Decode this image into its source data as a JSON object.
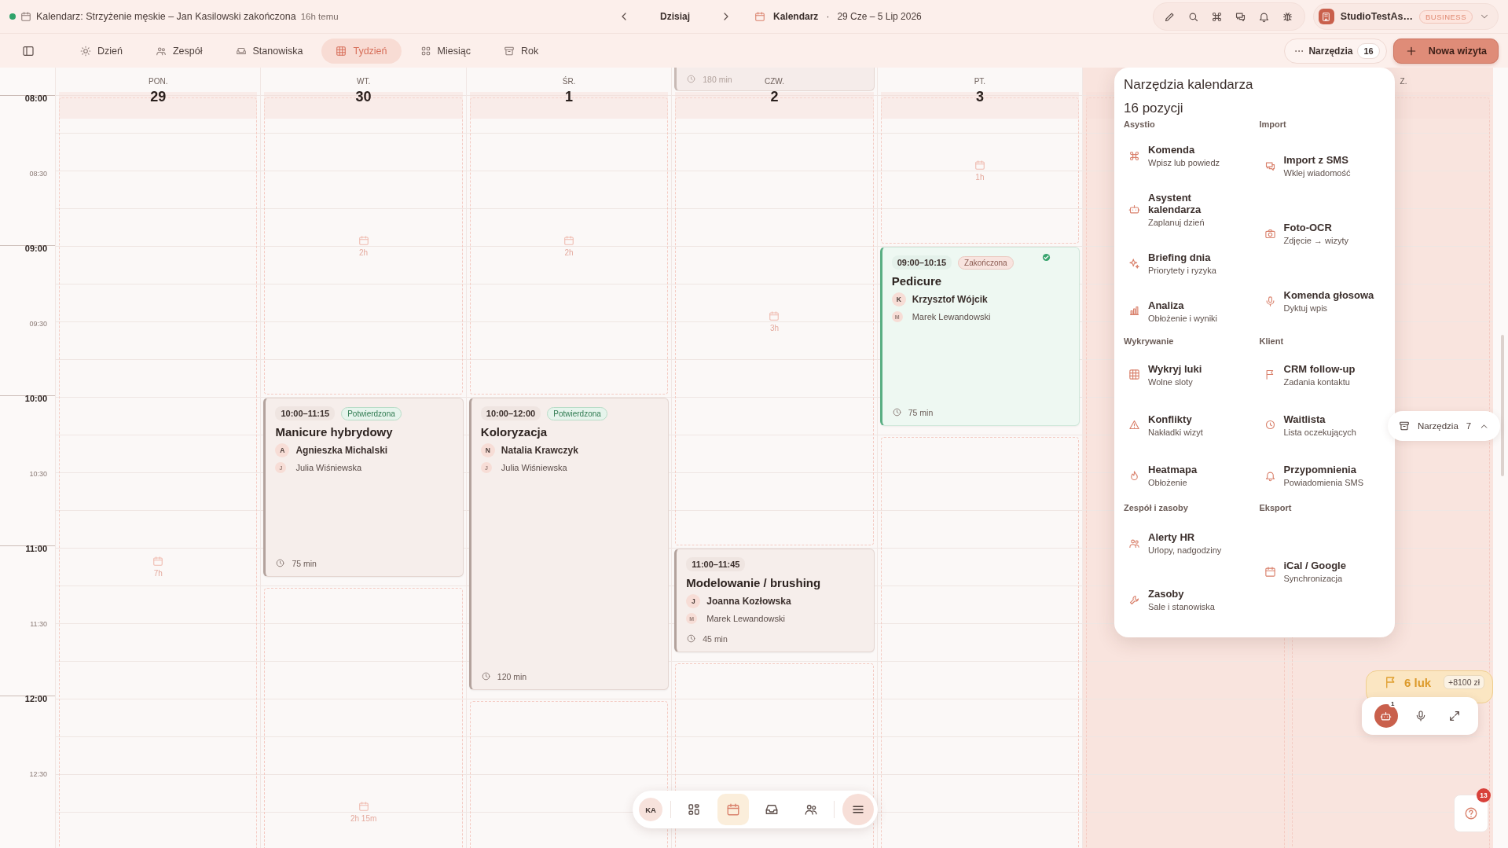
{
  "top_bar": {
    "status_title": "Kalendarz: Strzyżenie męskie – Jan Kasilowski zakończona",
    "status_time": "16h temu",
    "today": "Dzisiaj",
    "view_label": "Kalendarz",
    "separator": "·",
    "range": "29 Cze – 5 Lip 2026"
  },
  "account": {
    "name": "StudioTestAs…",
    "plan": "BUSINESS"
  },
  "toolbar": {
    "tabs": [
      {
        "label": "Dzień",
        "selected": false
      },
      {
        "label": "Zespół",
        "selected": false
      },
      {
        "label": "Stanowiska",
        "selected": false
      },
      {
        "label": "Tydzień",
        "selected": true
      },
      {
        "label": "Miesiąc",
        "selected": false
      },
      {
        "label": "Rok",
        "selected": false
      }
    ],
    "tools_button": {
      "dots": "···",
      "label": "Narzędzia",
      "count": "16"
    },
    "new_button": "Nowa wizyta"
  },
  "times": [
    {
      "label": "08:00",
      "major": true
    },
    {
      "label": "08:30",
      "major": false
    },
    {
      "label": "09:00",
      "major": true
    },
    {
      "label": "09:30",
      "major": false
    },
    {
      "label": "10:00",
      "major": true
    },
    {
      "label": "10:30",
      "major": false
    },
    {
      "label": "11:00",
      "major": true
    },
    {
      "label": "11:30",
      "major": false
    },
    {
      "label": "12:00",
      "major": true
    },
    {
      "label": "12:30",
      "major": false
    }
  ],
  "days": [
    {
      "label": "PON.",
      "number": "29",
      "weekend": false,
      "slots": [
        {
          "kind": "free",
          "label": "7h"
        }
      ]
    },
    {
      "label": "WT.",
      "number": "30",
      "weekend": false,
      "slots": [
        {
          "kind": "free",
          "label": "2h"
        },
        {
          "kind": "event",
          "time": "10:00–11:15",
          "status": "Potwierdzona",
          "completed": false,
          "title": "Manicure hybrydowy",
          "client": {
            "initial": "A",
            "name": "Agnieszka Michalski"
          },
          "staff": {
            "initial": "J",
            "name": "Julia Wiśniewska"
          },
          "duration": "75 min"
        },
        {
          "kind": "free",
          "label": "2h 15m"
        }
      ]
    },
    {
      "label": "ŚR.",
      "number": "1",
      "weekend": false,
      "slots": [
        {
          "kind": "free",
          "label": "2h"
        },
        {
          "kind": "event",
          "time": "10:00–12:00",
          "status": "Potwierdzona",
          "completed": false,
          "title": "Koloryzacja",
          "client": {
            "initial": "N",
            "name": "Natalia Krawczyk"
          },
          "staff": {
            "initial": "J",
            "name": "Julia Wiśniewska"
          },
          "duration": "120 min"
        },
        {
          "kind": "free"
        }
      ]
    },
    {
      "label": "CZW.",
      "number": "2",
      "weekend": false,
      "cut_event": {
        "duration": "180 min"
      },
      "slots": [
        {
          "kind": "free",
          "label": "3h"
        },
        {
          "kind": "event",
          "time": "11:00–11:45",
          "completed": false,
          "title": "Modelowanie / brushing",
          "client": {
            "initial": "J",
            "name": "Joanna Kozłowska"
          },
          "staff": {
            "initial": "M",
            "name": "Marek Lewandowski"
          },
          "duration": "45 min"
        },
        {
          "kind": "free"
        }
      ]
    },
    {
      "label": "PT.",
      "number": "3",
      "weekend": false,
      "slots": [
        {
          "kind": "free",
          "label": "1h"
        },
        {
          "kind": "event",
          "time": "09:00–10:15",
          "status": "Zakończona",
          "completed": true,
          "title": "Pedicure",
          "client": {
            "initial": "K",
            "name": "Krzysztof Wójcik"
          },
          "staff": {
            "initial": "M",
            "name": "Marek Lewandowski"
          },
          "duration": "75 min"
        },
        {
          "kind": "free"
        }
      ]
    },
    {
      "weekend": true,
      "slots": [
        {
          "kind": "free"
        }
      ]
    },
    {
      "label": "Z.",
      "weekend": true,
      "slots": [
        {
          "kind": "free"
        }
      ]
    }
  ],
  "tools_panel": {
    "title": "Narzędzia kalendarza",
    "count": "16 pozycji",
    "sections": [
      {
        "title": "Asystio",
        "items": [
          {
            "title": "Komenda",
            "subtitle": "Wpisz lub powiedz"
          },
          {
            "title": "Asystent kalendarza",
            "subtitle": "Zaplanuj dzień"
          },
          {
            "title": "Briefing dnia",
            "subtitle": "Priorytety i ryzyka"
          },
          {
            "title": "Analiza",
            "subtitle": "Obłożenie i wyniki"
          }
        ]
      },
      {
        "title": "Import",
        "items": [
          {
            "title": "Import z SMS",
            "subtitle": "Wklej wiadomość"
          },
          {
            "title": "Foto-OCR",
            "subtitle": "Zdjęcie → wizyty"
          },
          {
            "title": "Komenda głosowa",
            "subtitle": "Dyktuj wpis"
          }
        ]
      },
      {
        "title": "Wykrywanie",
        "items": [
          {
            "title": "Wykryj luki",
            "subtitle": "Wolne sloty"
          },
          {
            "title": "Konflikty",
            "subtitle": "Nakładki wizyt"
          },
          {
            "title": "Heatmapa",
            "subtitle": "Obłożenie"
          }
        ]
      },
      {
        "title": "Klient",
        "items": [
          {
            "title": "CRM follow-up",
            "subtitle": "Zadania kontaktu"
          },
          {
            "title": "Waitlista",
            "subtitle": "Lista oczekujących"
          },
          {
            "title": "Przypomnienia",
            "subtitle": "Powiadomienia SMS"
          }
        ]
      },
      {
        "title": "Zespół i zasoby",
        "items": [
          {
            "title": "Alerty HR",
            "subtitle": "Urlopy, nadgodziny"
          },
          {
            "title": "Zasoby",
            "subtitle": "Sale i stanowiska"
          }
        ]
      },
      {
        "title": "Eksport",
        "items": [
          {
            "title": "iCal / Google",
            "subtitle": "Synchronizacja"
          }
        ]
      }
    ]
  },
  "tools_pill": {
    "label": "Narzędzia",
    "count": "7"
  },
  "gaps_widget": {
    "label": "6 luk",
    "amount": "+8100 zł"
  },
  "assistant_bar": {
    "badge": "1"
  },
  "dock": {
    "avatar": "KA",
    "items": [
      {
        "selected": false
      },
      {
        "selected": true
      },
      {
        "selected": false
      },
      {
        "selected": false
      }
    ]
  },
  "help": {
    "badge": "13"
  }
}
